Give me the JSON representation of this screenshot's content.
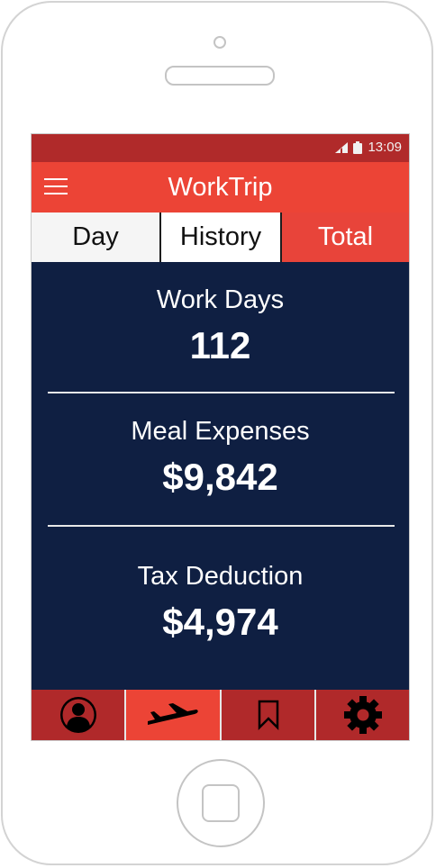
{
  "status_bar": {
    "time": "13:09",
    "signal_icon": "signal-icon",
    "battery_icon": "battery-icon"
  },
  "app_bar": {
    "title": "WorkTrip",
    "menu_icon": "hamburger-menu-icon"
  },
  "tabs": [
    {
      "label": "Day",
      "active": false
    },
    {
      "label": "History",
      "active": false
    },
    {
      "label": "Total",
      "active": true
    }
  ],
  "stats": [
    {
      "label": "Work Days",
      "value": "112"
    },
    {
      "label": "Meal Expenses",
      "value": "$9,842"
    },
    {
      "label": "Tax Deduction",
      "value": "$4,974"
    }
  ],
  "bottom_nav": [
    {
      "icon": "profile-icon",
      "active": false
    },
    {
      "icon": "airplane-icon",
      "active": true
    },
    {
      "icon": "bookmark-icon",
      "active": false
    },
    {
      "icon": "settings-gear-icon",
      "active": false
    }
  ],
  "colors": {
    "primary_red": "#ec4436",
    "dark_red": "#b02a2a",
    "navy": "#0f1f42"
  }
}
